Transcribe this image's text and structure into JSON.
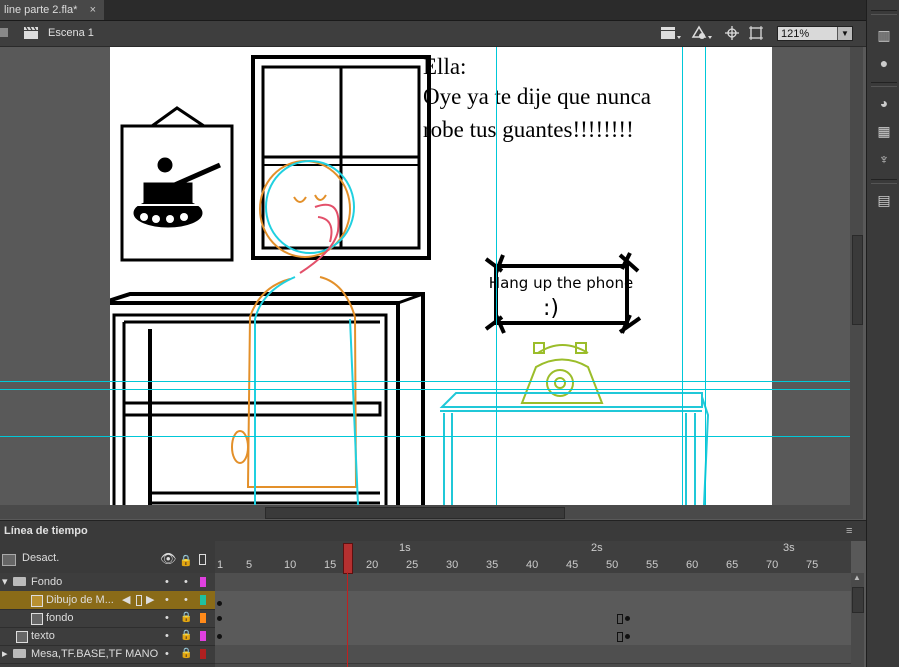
{
  "document_tab": {
    "title": "line parte 2.fla*",
    "close": "×"
  },
  "editbar": {
    "scene_label": "Escena 1",
    "zoom_value": "121%"
  },
  "stage": {
    "dialogue": {
      "speaker": "Ella:",
      "line1": "Oye ya te dije que nunca",
      "line2": "robe tus guantes!!!!!!!!"
    },
    "sign": {
      "line1": "Hang up the phone",
      "line2": ":)"
    }
  },
  "timeline": {
    "title": "Línea de tiempo",
    "sec_marks": [
      "1s",
      "2s",
      "3s"
    ],
    "frame_marks": [
      "1",
      "5",
      "10",
      "15",
      "20",
      "25",
      "30",
      "35",
      "40",
      "45",
      "50",
      "55",
      "60",
      "65",
      "70",
      "75"
    ],
    "off_label": "Desact.",
    "layers": [
      {
        "name": "Fondo",
        "type": "folder",
        "color": "#e040e0"
      },
      {
        "name": "Dibujo de M...",
        "type": "layer",
        "selected": true,
        "color": "#20c0a0"
      },
      {
        "name": "fondo",
        "type": "layer",
        "color": "#ff8a1a"
      },
      {
        "name": "texto",
        "type": "layer",
        "color": "#e040e0"
      },
      {
        "name": "Mesa,TF.BASE,TF MANO",
        "type": "folder",
        "color": "#b02020"
      }
    ],
    "current_frame": 17
  },
  "colors": {
    "selected_layer": "#8a6b18",
    "playhead": "#c02020",
    "guide": "#00c8d8"
  }
}
